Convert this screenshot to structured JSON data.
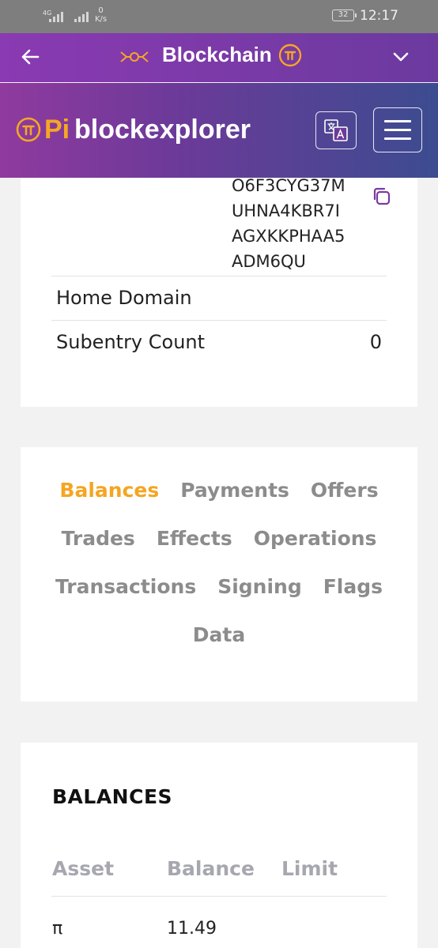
{
  "status_bar": {
    "network": "4G",
    "speed_value": "0",
    "speed_unit": "K/s",
    "battery": "32",
    "time": "12:17"
  },
  "header": {
    "title": "Blockchain",
    "back_icon": "back-arrow-icon",
    "menu_icon": "chevron-down-icon"
  },
  "banner": {
    "pi": "Pi",
    "name": "blockexplorer"
  },
  "account": {
    "address_lines": [
      "O6F3CYG37M",
      "UHNA4KBR7I",
      "AGXKKPHAA5",
      "ADM6QU"
    ],
    "rows": [
      {
        "label": "Home Domain",
        "value": ""
      },
      {
        "label": "Subentry Count",
        "value": "0"
      }
    ]
  },
  "tabs": {
    "row1": [
      "Balances",
      "Payments",
      "Offers"
    ],
    "row2": [
      "Trades",
      "Effects",
      "Operations"
    ],
    "row3": [
      "Transactions",
      "Signing",
      "Flags"
    ],
    "row4": [
      "Data"
    ],
    "active": "Balances"
  },
  "balances": {
    "title": "BALANCES",
    "columns": [
      "Asset",
      "Balance",
      "Limit"
    ],
    "rows": [
      {
        "asset": "π",
        "balance": "11.49",
        "limit": ""
      }
    ]
  },
  "colors": {
    "accent": "#f4a522",
    "header_purple": "#7b3aa8",
    "tab_inactive": "#8c8c8c"
  }
}
